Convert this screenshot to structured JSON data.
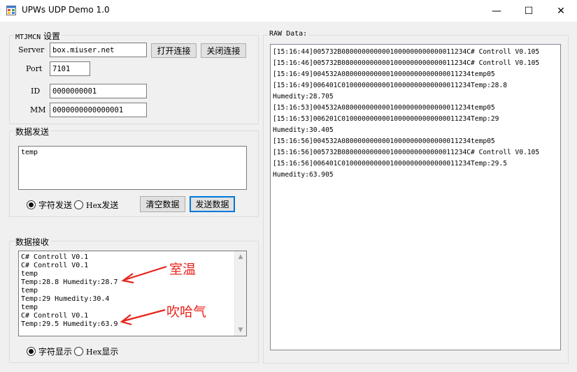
{
  "window": {
    "title": "UPWs UDP Demo 1.0",
    "minimize_glyph": "—",
    "maximize_glyph": "☐",
    "close_glyph": "✕",
    "icon": "app-window-icon"
  },
  "settings": {
    "group_title_mono": "MTJMCN",
    "group_title_cn": " 设置",
    "server_label": "Server",
    "server_value": "box.miuser.net",
    "port_label": "Port",
    "port_value": "7101",
    "id_label": "ID",
    "id_value": "0000000001",
    "mm_label": "MM",
    "mm_value": "0000000000000001",
    "open_button": "打开连接",
    "close_button": "关闭连接"
  },
  "send": {
    "group_title": "数据发送",
    "content": "temp",
    "radio_char": "字符发送",
    "radio_hex_prefix": "Hex",
    "radio_hex_suffix": "发送",
    "radio_selected": "char",
    "clear_button": "清空数据",
    "send_button": "发送数据"
  },
  "receive": {
    "group_title": "数据接收",
    "content": "C# Controll V0.1\nC# Controll V0.1\ntemp\nTemp:28.8 Humedity:28.7\ntemp\nTemp:29 Humedity:30.4\ntemp\nC# Controll V0.1\nTemp:29.5 Humedity:63.9",
    "radio_char": "字符显示",
    "radio_hex_prefix": "Hex",
    "radio_hex_suffix": "显示",
    "radio_selected": "char"
  },
  "raw": {
    "group_title": "RAW Data:",
    "lines": [
      "[15:16:44]005732B0800000000001000000000000011234C# Controll V0.105",
      "[15:16:46]005732B0800000000001000000000000011234C# Controll V0.105",
      "[15:16:49]004532A08000000000010000000000000011234temp05",
      "[15:16:49]006401C01000000000010000000000000011234Temp:28.8",
      "Humedity:28.705",
      "[15:16:53]004532A08000000000010000000000000011234temp05",
      "[15:16:53]006201C01000000000010000000000000011234Temp:29",
      "Humedity:30.405",
      "[15:16:56]004532A08000000000010000000000000011234temp05",
      "[15:16:56]005732B0800000000001000000000000011234C# Controll V0.105",
      "[15:16:56]006401C01000000000010000000000000011234Temp:29.5",
      "Humedity:63.905"
    ]
  },
  "annotations": {
    "room_temp": "室温",
    "breath": "吹哈气",
    "color": "#e8231c"
  }
}
